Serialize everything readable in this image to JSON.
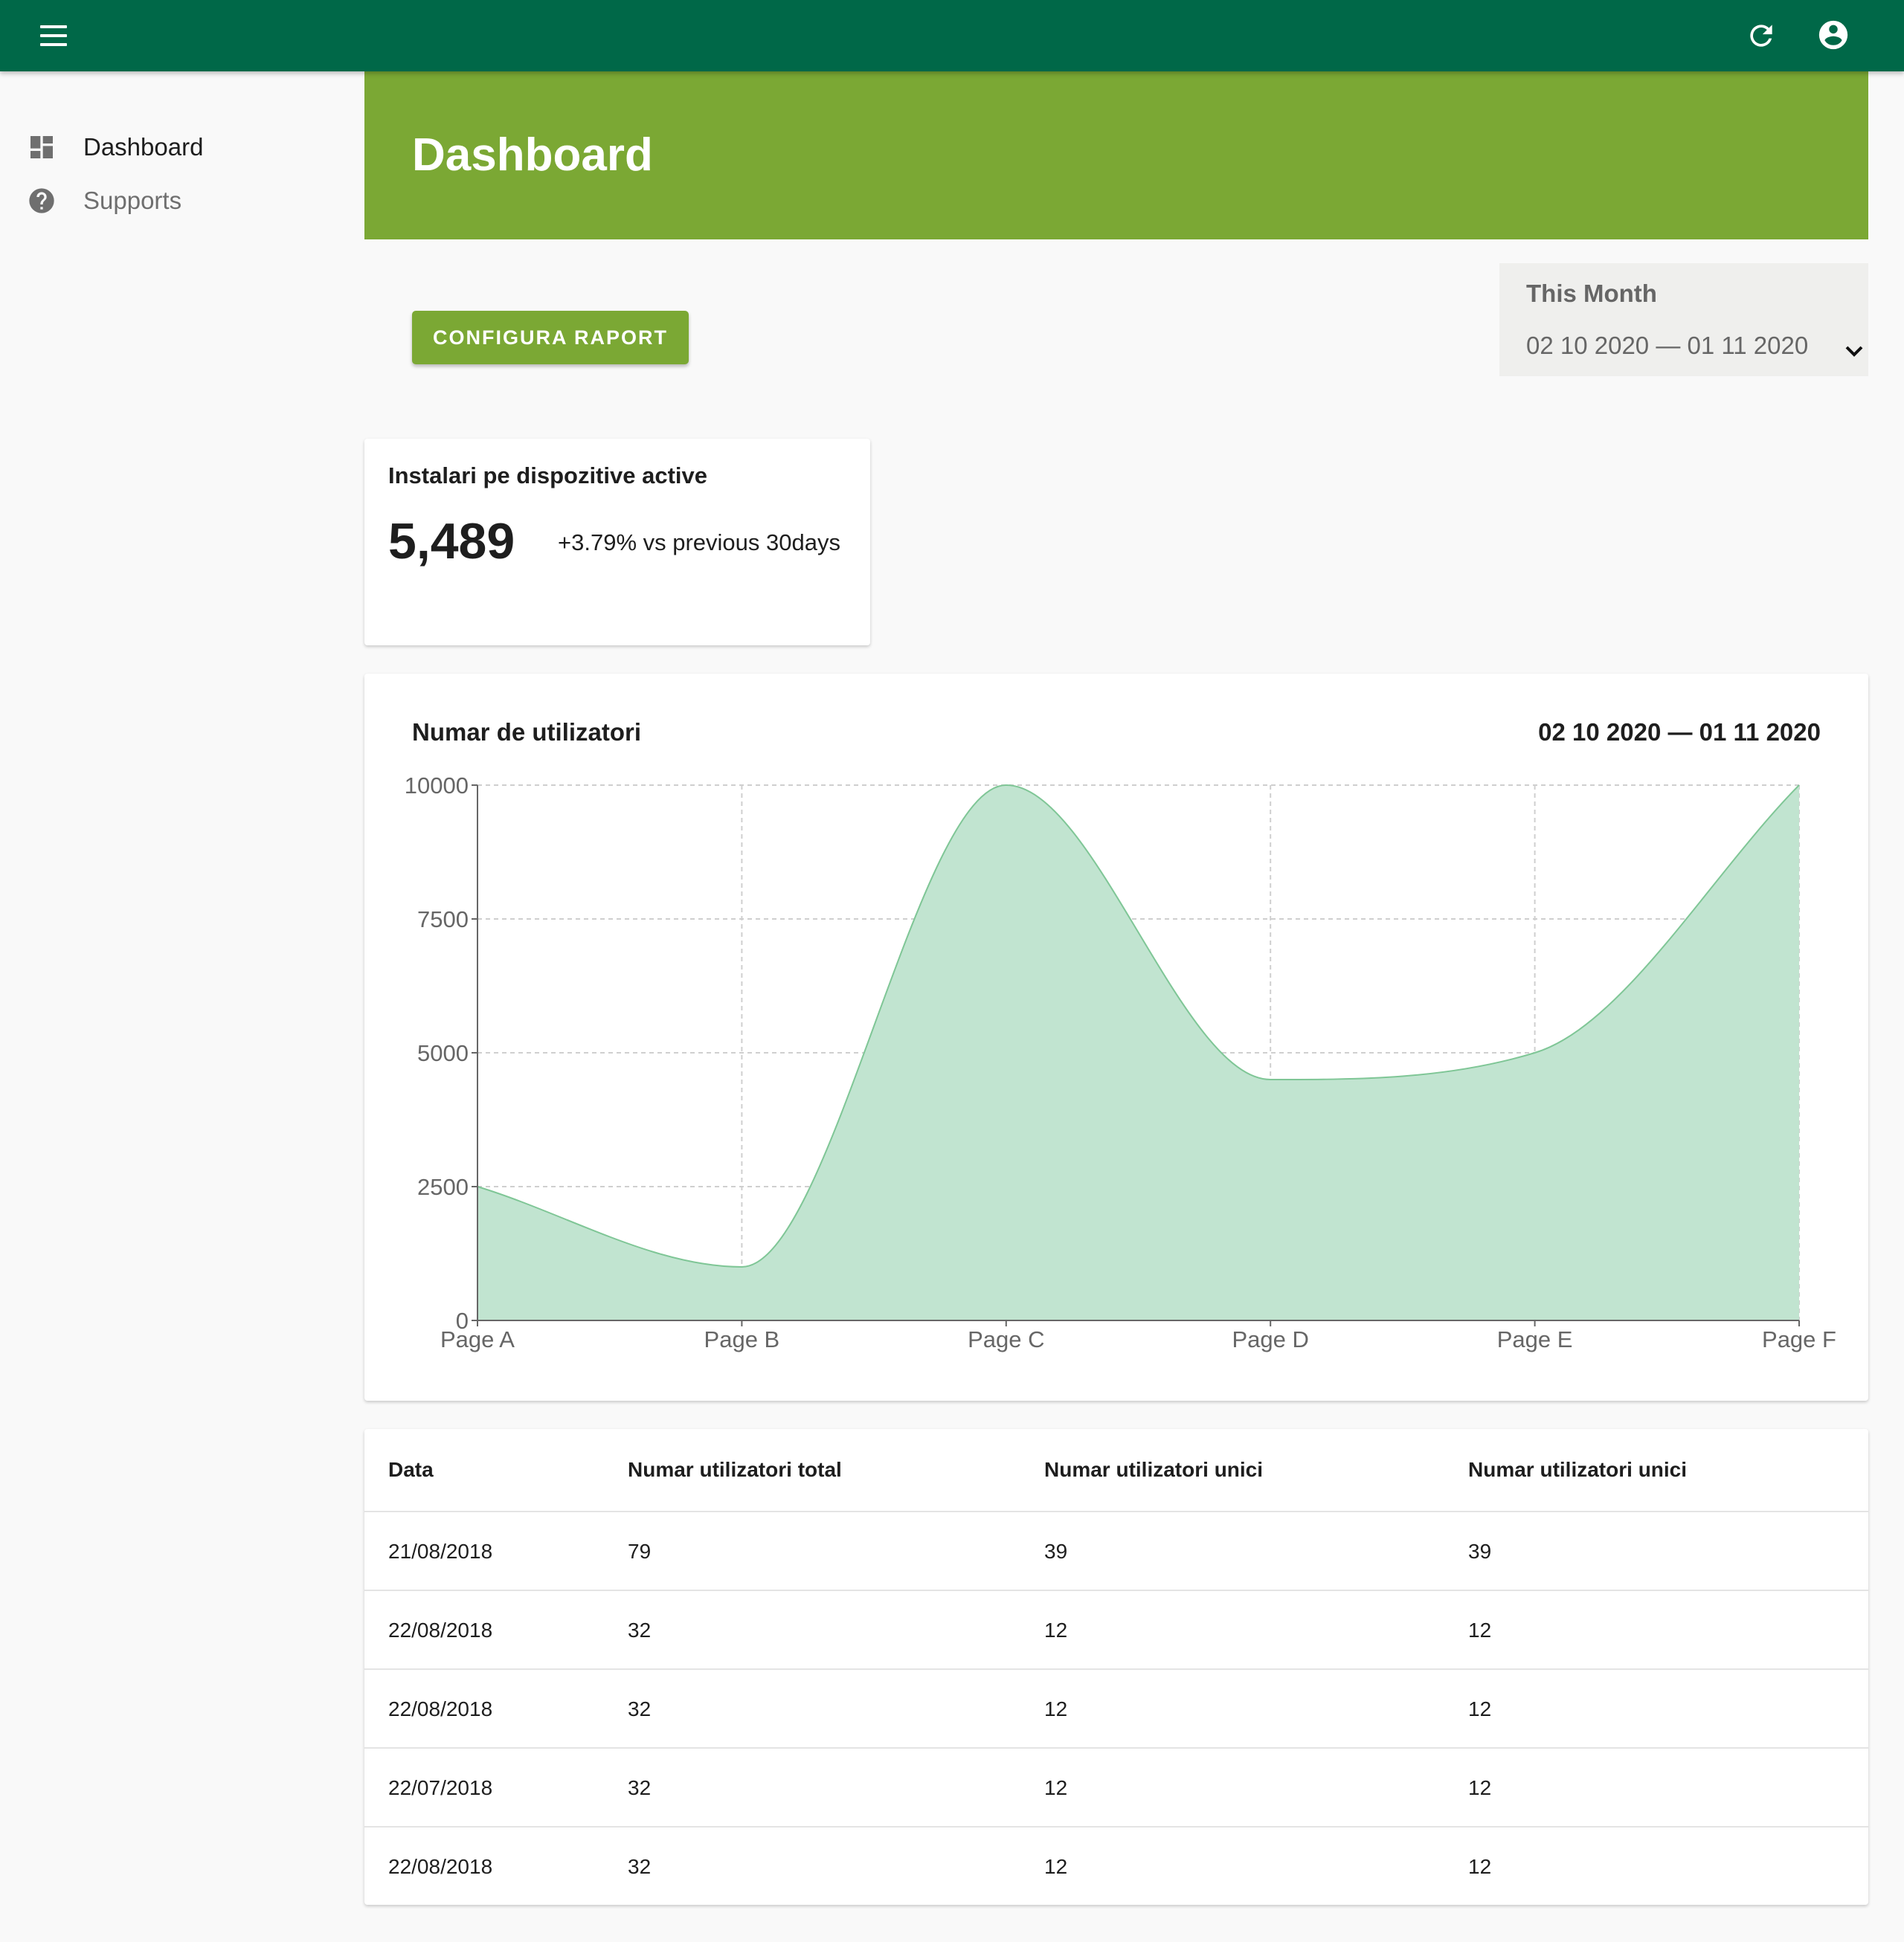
{
  "appbar": {
    "menu_icon": "menu-icon",
    "refresh_icon": "refresh-icon",
    "account_icon": "account-circle-icon",
    "bg_color": "#006848"
  },
  "sidebar": {
    "items": [
      {
        "label": "Dashboard",
        "icon": "dashboard-icon"
      },
      {
        "label": "Supports",
        "icon": "help-circle-icon"
      }
    ]
  },
  "header": {
    "title": "Dashboard",
    "bg_color": "#7ba834"
  },
  "toolbar": {
    "config_label": "CONFIGURA RAPORT"
  },
  "date_filter": {
    "label": "This Month",
    "value": "02 10 2020 — 01 11 2020"
  },
  "stat_card": {
    "title": "Instalari pe dispozitive active",
    "value": "5,489",
    "change": "+3.79% vs previous 30days"
  },
  "chart_card": {
    "title": "Numar de utilizatori",
    "range": "02 10 2020 — 01 11 2020"
  },
  "chart_data": {
    "type": "area",
    "categories": [
      "Page A",
      "Page B",
      "Page C",
      "Page D",
      "Page E",
      "Page F"
    ],
    "values": [
      2500,
      1000,
      10000,
      4500,
      5000,
      10000
    ],
    "ylim": [
      0,
      10000
    ],
    "yticks": [
      "0",
      "2500",
      "5000",
      "7500",
      "10000"
    ],
    "grid": true,
    "fill_color": "#c1e4d0",
    "line_color": "#7fc696"
  },
  "table": {
    "headers": [
      "Data",
      "Numar utilizatori total",
      "Numar utilizatori unici",
      "Numar utilizatori unici"
    ],
    "rows": [
      [
        "21/08/2018",
        "79",
        "39",
        "39"
      ],
      [
        "22/08/2018",
        "32",
        "12",
        "12"
      ],
      [
        "22/08/2018",
        "32",
        "12",
        "12"
      ],
      [
        "22/07/2018",
        "32",
        "12",
        "12"
      ],
      [
        "22/08/2018",
        "32",
        "12",
        "12"
      ]
    ]
  }
}
